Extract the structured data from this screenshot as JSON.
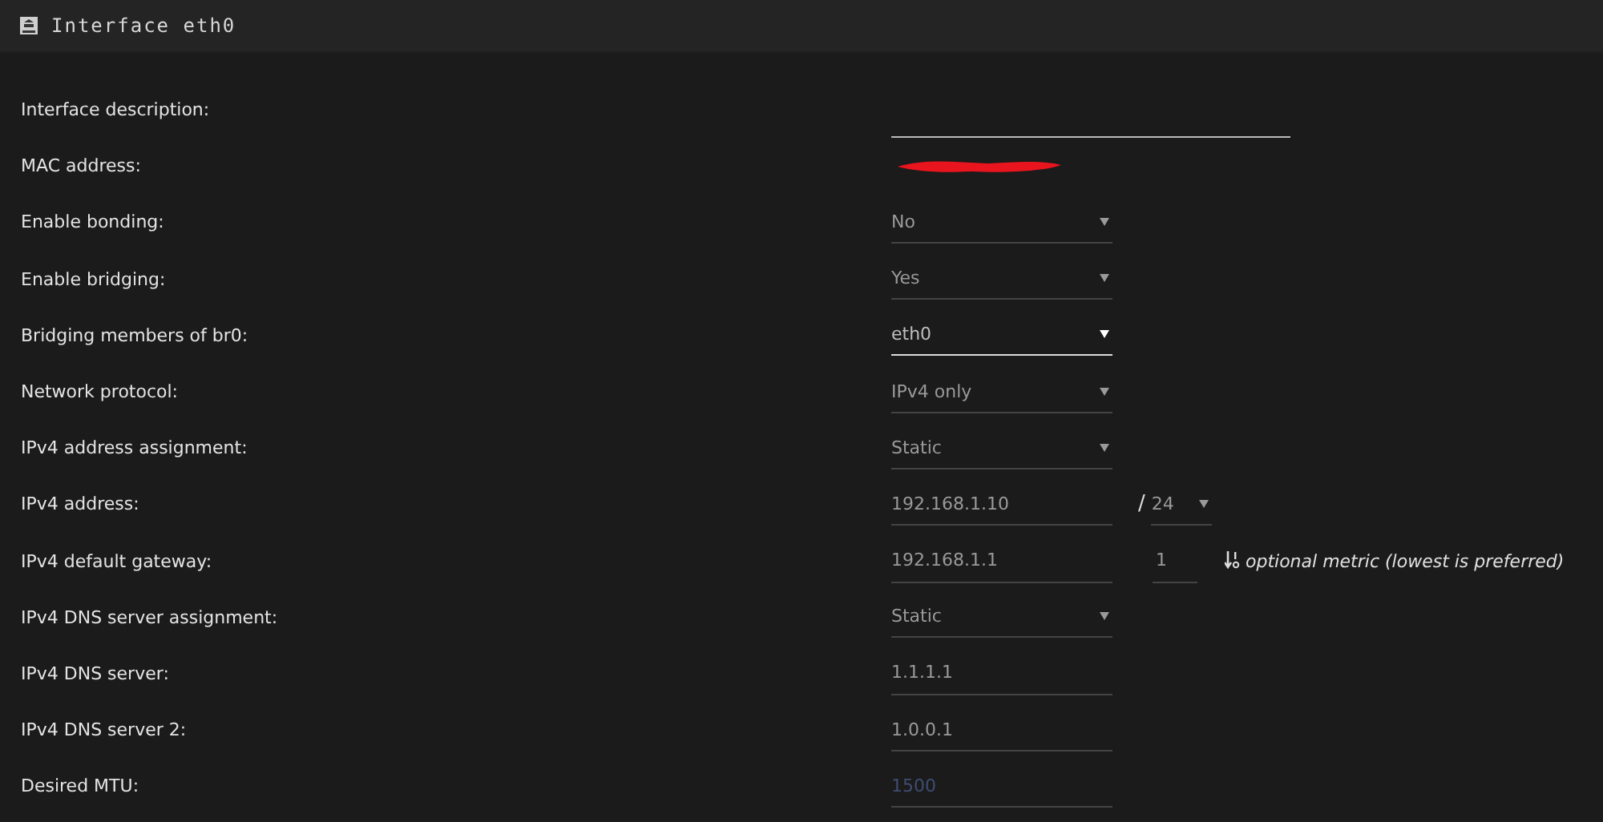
{
  "panel": {
    "title": "Interface eth0"
  },
  "rows": [
    {
      "label": "Interface description:",
      "kind": "text",
      "wide": true,
      "focused": false
    },
    {
      "label": "MAC address:",
      "kind": "redacted"
    },
    {
      "label": "Enable bonding:",
      "kind": "select",
      "value": "No",
      "focused": false
    },
    {
      "label": "Enable bridging:",
      "kind": "select",
      "value": "Yes",
      "focused": false
    },
    {
      "label": "Bridging members of br0:",
      "kind": "select",
      "value": "eth0",
      "focused": true
    },
    {
      "label": "Network protocol:",
      "kind": "select",
      "value": "IPv4 only",
      "focused": false
    },
    {
      "label": "IPv4 address assignment:",
      "kind": "select",
      "value": "Static",
      "focused": false
    },
    {
      "label": "IPv4 address:",
      "kind": "text",
      "value": "192.168.1.10",
      "focused": false,
      "extra": {
        "kind": "prefix",
        "separator": "/",
        "value": "24"
      }
    },
    {
      "label": "IPv4 default gateway:",
      "kind": "text",
      "value": "192.168.1.1",
      "focused": false,
      "extra": {
        "kind": "metric",
        "value": "1",
        "hint": "optional metric (lowest is preferred)"
      }
    },
    {
      "label": "IPv4 DNS server assignment:",
      "kind": "select",
      "value": "Static",
      "focused": false
    },
    {
      "label": "IPv4 DNS server:",
      "kind": "text",
      "value": "1.1.1.1",
      "focused": false
    },
    {
      "label": "IPv4 DNS server 2:",
      "kind": "text",
      "value": "1.0.0.1",
      "focused": false
    },
    {
      "label": "Desired MTU:",
      "kind": "text",
      "placeholder": "1500",
      "focused": false
    }
  ]
}
